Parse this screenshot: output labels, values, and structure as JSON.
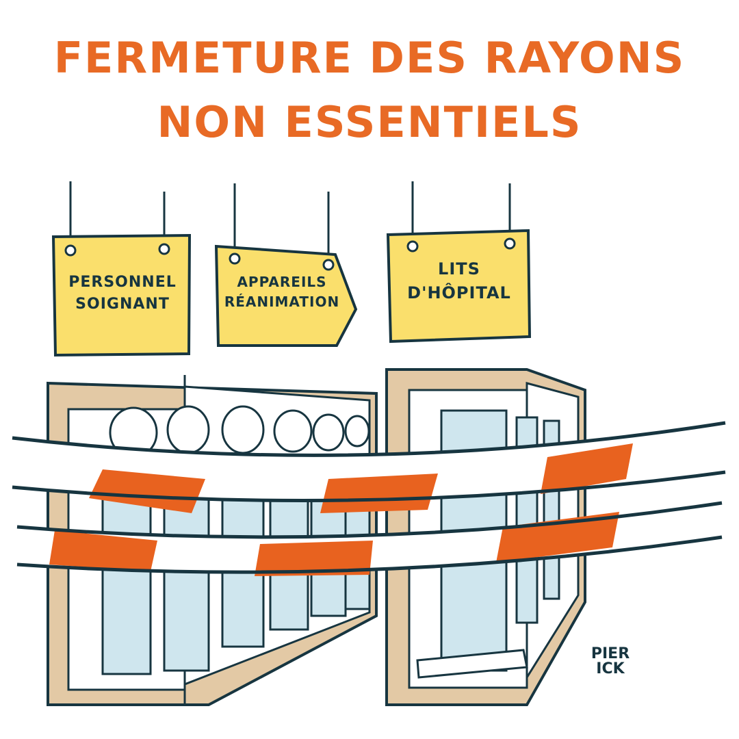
{
  "title": {
    "line1": "FERMETURE DES RAYONS",
    "line2": "NON ESSENTIELS"
  },
  "signs": [
    {
      "line1": "PERSONNEL",
      "line2": "SOIGNANT"
    },
    {
      "line1": "APPAREILS",
      "line2": "RÉANIMATION"
    },
    {
      "line1": "LITS",
      "line2": "D'HÔPITAL"
    }
  ],
  "signature": {
    "line1": "PIER",
    "line2": "ICK"
  },
  "colors": {
    "title": "#E86A25",
    "sign_fill": "#FADF6C",
    "ink": "#173540",
    "tape_orange": "#E8621F",
    "cabinet_frame": "#E3C9A5",
    "glass": "#CFE6EE"
  }
}
